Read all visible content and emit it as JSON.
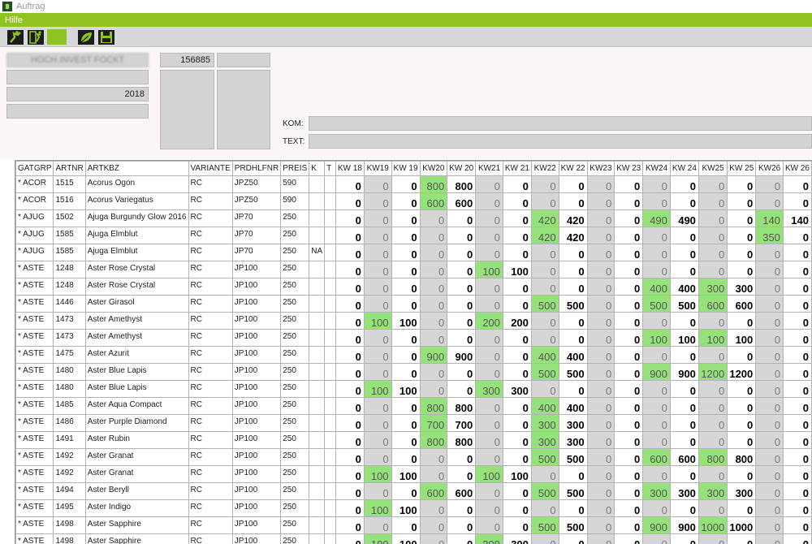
{
  "window": {
    "title": "Auftrag"
  },
  "menu": {
    "help_label": "Hilfe"
  },
  "toolbar": {
    "buttons": [
      "run-icon",
      "exit-icon",
      "blank-button",
      "leaf-icon",
      "save-icon"
    ]
  },
  "colors": {
    "accent": "#8fc31f",
    "highlight": "#96e27a",
    "field_bg": "#d3d3d3"
  },
  "form": {
    "name_value": "HOCH INVEST FOCKT",
    "field2_value": "",
    "year_value": "2018",
    "field4_value": "",
    "number_value": "156885",
    "number2_value": "",
    "kom_label": "KOM:",
    "kom_value": "",
    "text_label": "TEXT:",
    "text_value": ""
  },
  "grid": {
    "headers": [
      "GATGRP",
      "ARTNR",
      "ARTKBZ",
      "VARIANTE",
      "PRDHLFNR",
      "PREIS",
      "K",
      "T",
      "KW 18",
      "KW19",
      "KW 19",
      "KW20",
      "KW 20",
      "KW21",
      "KW 21",
      "KW22",
      "KW 22",
      "KW23",
      "KW 23",
      "KW24",
      "KW 24",
      "KW25",
      "KW 25",
      "KW26",
      "KW 26"
    ],
    "rows": [
      {
        "g": "* ACOR",
        "nr": "1515",
        "name": "Acorus Ogon",
        "v": "RC",
        "p": "JPZ50",
        "pr": "590",
        "k": "",
        "t": "",
        "q": [
          "0",
          "0",
          "0",
          "800",
          "800",
          "0",
          "0",
          "0",
          "0",
          "0",
          "0",
          "0",
          "0",
          "0",
          "0",
          "0",
          "0"
        ]
      },
      {
        "g": "* ACOR",
        "nr": "1516",
        "name": "Acorus Variegatus",
        "v": "RC",
        "p": "JPZ50",
        "pr": "590",
        "k": "",
        "t": "",
        "q": [
          "0",
          "0",
          "0",
          "600",
          "600",
          "0",
          "0",
          "0",
          "0",
          "0",
          "0",
          "0",
          "0",
          "0",
          "0",
          "0",
          "0"
        ]
      },
      {
        "g": "* AJUG",
        "nr": "1502",
        "name": "Ajuga Burgundy Glow 2016",
        "v": "RC",
        "p": "JP70",
        "pr": "250",
        "k": "",
        "t": "",
        "q": [
          "0",
          "0",
          "0",
          "0",
          "0",
          "0",
          "0",
          "420",
          "420",
          "0",
          "0",
          "490",
          "490",
          "0",
          "0",
          "140",
          "140"
        ]
      },
      {
        "g": "* AJUG",
        "nr": "1585",
        "name": "Ajuga Elmblut",
        "v": "RC",
        "p": "JP70",
        "pr": "250",
        "k": "",
        "t": "",
        "q": [
          "0",
          "0",
          "0",
          "0",
          "0",
          "0",
          "0",
          "420",
          "420",
          "0",
          "0",
          "0",
          "0",
          "0",
          "0",
          "350",
          "0"
        ]
      },
      {
        "g": "* AJUG",
        "nr": "1585",
        "name": "Ajuga Elmblut",
        "v": "RC",
        "p": "JP70",
        "pr": "250",
        "k": "NA",
        "t": "",
        "q": [
          "0",
          "0",
          "0",
          "0",
          "0",
          "0",
          "0",
          "0",
          "0",
          "0",
          "0",
          "0",
          "0",
          "0",
          "0",
          "0",
          "0"
        ]
      },
      {
        "g": "* ASTE",
        "nr": "1248",
        "name": "Aster Rose Crystal",
        "v": "RC",
        "p": "JP100",
        "pr": "250",
        "k": "",
        "t": "",
        "q": [
          "0",
          "0",
          "0",
          "0",
          "0",
          "100",
          "100",
          "0",
          "0",
          "0",
          "0",
          "0",
          "0",
          "0",
          "0",
          "0",
          "0"
        ]
      },
      {
        "g": "* ASTE",
        "nr": "1248",
        "name": "Aster Rose Crystal",
        "v": "RC",
        "p": "JP100",
        "pr": "250",
        "k": "",
        "t": "",
        "q": [
          "0",
          "0",
          "0",
          "0",
          "0",
          "0",
          "0",
          "0",
          "0",
          "0",
          "0",
          "400",
          "400",
          "300",
          "300",
          "0",
          "0"
        ]
      },
      {
        "g": "* ASTE",
        "nr": "1446",
        "name": "Aster Girasol",
        "v": "RC",
        "p": "JP100",
        "pr": "250",
        "k": "",
        "t": "",
        "q": [
          "0",
          "0",
          "0",
          "0",
          "0",
          "0",
          "0",
          "500",
          "500",
          "0",
          "0",
          "500",
          "500",
          "600",
          "600",
          "0",
          "0"
        ]
      },
      {
        "g": "* ASTE",
        "nr": "1473",
        "name": "Aster Amethyst",
        "v": "RC",
        "p": "JP100",
        "pr": "250",
        "k": "",
        "t": "",
        "q": [
          "0",
          "100",
          "100",
          "0",
          "0",
          "200",
          "200",
          "0",
          "0",
          "0",
          "0",
          "0",
          "0",
          "0",
          "0",
          "0",
          "0"
        ]
      },
      {
        "g": "* ASTE",
        "nr": "1473",
        "name": "Aster Amethyst",
        "v": "RC",
        "p": "JP100",
        "pr": "250",
        "k": "",
        "t": "",
        "q": [
          "0",
          "0",
          "0",
          "0",
          "0",
          "0",
          "0",
          "0",
          "0",
          "0",
          "0",
          "100",
          "100",
          "100",
          "100",
          "0",
          "0"
        ]
      },
      {
        "g": "* ASTE",
        "nr": "1475",
        "name": "Aster Azurit",
        "v": "RC",
        "p": "JP100",
        "pr": "250",
        "k": "",
        "t": "",
        "q": [
          "0",
          "0",
          "0",
          "900",
          "900",
          "0",
          "0",
          "400",
          "400",
          "0",
          "0",
          "0",
          "0",
          "0",
          "0",
          "0",
          "0"
        ]
      },
      {
        "g": "* ASTE",
        "nr": "1480",
        "name": "Aster Blue Lapis",
        "v": "RC",
        "p": "JP100",
        "pr": "250",
        "k": "",
        "t": "",
        "q": [
          "0",
          "0",
          "0",
          "0",
          "0",
          "0",
          "0",
          "500",
          "500",
          "0",
          "0",
          "900",
          "900",
          "1200",
          "1200",
          "0",
          "0"
        ]
      },
      {
        "g": "* ASTE",
        "nr": "1480",
        "name": "Aster Blue Lapis",
        "v": "RC",
        "p": "JP100",
        "pr": "250",
        "k": "",
        "t": "",
        "q": [
          "0",
          "100",
          "100",
          "0",
          "0",
          "300",
          "300",
          "0",
          "0",
          "0",
          "0",
          "0",
          "0",
          "0",
          "0",
          "0",
          "0"
        ]
      },
      {
        "g": "* ASTE",
        "nr": "1485",
        "name": "Aster Aqua Compact",
        "v": "RC",
        "p": "JP100",
        "pr": "250",
        "k": "",
        "t": "",
        "q": [
          "0",
          "0",
          "0",
          "800",
          "800",
          "0",
          "0",
          "400",
          "400",
          "0",
          "0",
          "0",
          "0",
          "0",
          "0",
          "0",
          "0"
        ]
      },
      {
        "g": "* ASTE",
        "nr": "1486",
        "name": "Aster Purple Diamond",
        "v": "RC",
        "p": "JP100",
        "pr": "250",
        "k": "",
        "t": "",
        "q": [
          "0",
          "0",
          "0",
          "700",
          "700",
          "0",
          "0",
          "300",
          "300",
          "0",
          "0",
          "0",
          "0",
          "0",
          "0",
          "0",
          "0"
        ]
      },
      {
        "g": "* ASTE",
        "nr": "1491",
        "name": "Aster Rubin",
        "v": "RC",
        "p": "JP100",
        "pr": "250",
        "k": "",
        "t": "",
        "q": [
          "0",
          "0",
          "0",
          "800",
          "800",
          "0",
          "0",
          "300",
          "300",
          "0",
          "0",
          "0",
          "0",
          "0",
          "0",
          "0",
          "0"
        ]
      },
      {
        "g": "* ASTE",
        "nr": "1492",
        "name": "Aster Granat",
        "v": "RC",
        "p": "JP100",
        "pr": "250",
        "k": "",
        "t": "",
        "q": [
          "0",
          "0",
          "0",
          "0",
          "0",
          "0",
          "0",
          "500",
          "500",
          "0",
          "0",
          "600",
          "600",
          "800",
          "800",
          "0",
          "0"
        ]
      },
      {
        "g": "* ASTE",
        "nr": "1492",
        "name": "Aster Granat",
        "v": "RC",
        "p": "JP100",
        "pr": "250",
        "k": "",
        "t": "",
        "q": [
          "0",
          "100",
          "100",
          "0",
          "0",
          "100",
          "100",
          "0",
          "0",
          "0",
          "0",
          "0",
          "0",
          "0",
          "0",
          "0",
          "0"
        ]
      },
      {
        "g": "* ASTE",
        "nr": "1494",
        "name": "Aster Beryll",
        "v": "RC",
        "p": "JP100",
        "pr": "250",
        "k": "",
        "t": "",
        "q": [
          "0",
          "0",
          "0",
          "600",
          "600",
          "0",
          "0",
          "500",
          "500",
          "0",
          "0",
          "300",
          "300",
          "300",
          "300",
          "0",
          "0"
        ]
      },
      {
        "g": "* ASTE",
        "nr": "1495",
        "name": "Aster Indigo",
        "v": "RC",
        "p": "JP100",
        "pr": "250",
        "k": "",
        "t": "",
        "q": [
          "0",
          "100",
          "100",
          "0",
          "0",
          "0",
          "0",
          "0",
          "0",
          "0",
          "0",
          "0",
          "0",
          "0",
          "0",
          "0",
          "0"
        ]
      },
      {
        "g": "* ASTE",
        "nr": "1498",
        "name": "Aster Sapphire",
        "v": "RC",
        "p": "JP100",
        "pr": "250",
        "k": "",
        "t": "",
        "q": [
          "0",
          "0",
          "0",
          "0",
          "0",
          "0",
          "0",
          "500",
          "500",
          "0",
          "0",
          "900",
          "900",
          "1000",
          "1000",
          "0",
          "0"
        ]
      },
      {
        "g": "* ASTE",
        "nr": "1498",
        "name": "Aster Sapphire",
        "v": "RC",
        "p": "JP100",
        "pr": "250",
        "k": "",
        "t": "",
        "q": [
          "0",
          "100",
          "100",
          "0",
          "0",
          "300",
          "300",
          "0",
          "0",
          "0",
          "0",
          "0",
          "0",
          "0",
          "0",
          "0",
          "0"
        ]
      }
    ]
  }
}
